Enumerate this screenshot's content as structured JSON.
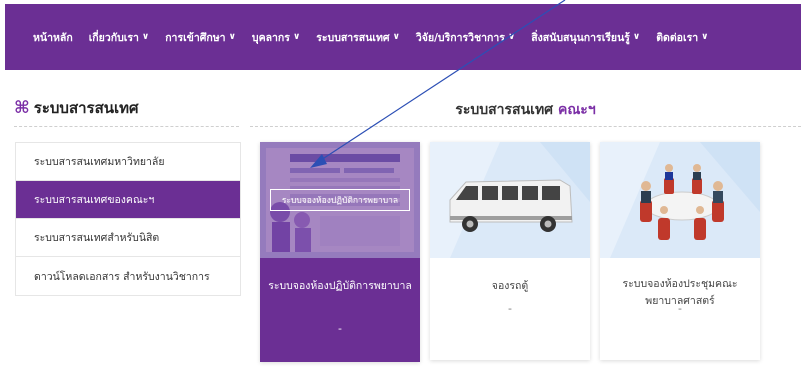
{
  "nav": {
    "items": [
      {
        "label": "หน้าหลัก",
        "has_dropdown": false
      },
      {
        "label": "เกี่ยวกับเรา",
        "has_dropdown": true
      },
      {
        "label": "การเข้าศึกษา",
        "has_dropdown": true
      },
      {
        "label": "บุคลากร",
        "has_dropdown": true
      },
      {
        "label": "ระบบสารสนเทศ",
        "has_dropdown": true
      },
      {
        "label": "วิจัย/บริการวิชาการ",
        "has_dropdown": true
      },
      {
        "label": "สิ่งสนับสนุนการเรียนรู้",
        "has_dropdown": true
      },
      {
        "label": "ติดต่อเรา",
        "has_dropdown": true
      }
    ],
    "chevron": "∨"
  },
  "sidebar": {
    "title": "ระบบสารสนเทศ",
    "title_icon": "⌘",
    "items": [
      {
        "label": "ระบบสารสนเทศมหาวิทยาลัย",
        "active": false
      },
      {
        "label": "ระบบสารสนเทศของคณะฯ",
        "active": true
      },
      {
        "label": "ระบบสารสนเทศสำหรับนิสิต",
        "active": false
      },
      {
        "label": "ดาวน์โหลดเอกสาร สำหรับงานวิชาการ",
        "active": false
      }
    ]
  },
  "main": {
    "title_prefix": "ระบบสารสนเทศ",
    "title_accent": "คณะฯ",
    "cards": [
      {
        "title": "ระบบจองห้องปฏิบัติการพยาบาล",
        "dash": "-",
        "overlay_label": "ระบบจองห้องปฏิบัติการพยาบาล",
        "active": true
      },
      {
        "title": "จองรถตู้",
        "dash": "-",
        "active": false
      },
      {
        "title": "ระบบจองห้องประชุมคณะพยาบาลศาสตร์",
        "dash": "-",
        "active": false
      }
    ]
  },
  "colors": {
    "brand": "#6b2f94",
    "annotation_arrow": "#2c4fb5"
  }
}
